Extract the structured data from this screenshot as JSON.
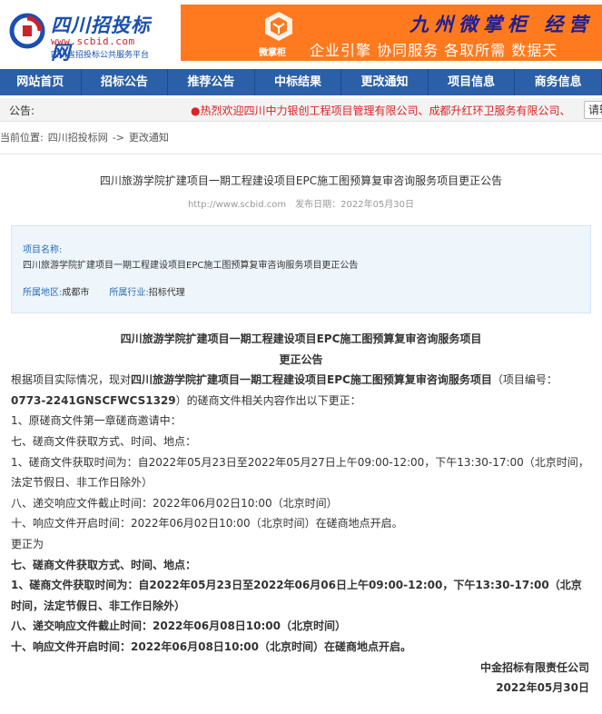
{
  "header": {
    "logo_title": "四川招投标网",
    "logo_url": "www.scbid.com",
    "logo_sub": "四川省招投标公共服务平台",
    "banner_brand": "微掌柜",
    "banner_title": "九州微掌柜 经营",
    "banner_slogan": "企业引擎 协同服务 各取所需   数据天"
  },
  "nav": {
    "items": [
      "网站首页",
      "招标公告",
      "推荐公告",
      "中标结果",
      "更改通知",
      "项目信息",
      "商务信息"
    ]
  },
  "notice": {
    "label": "公告:",
    "text": "●热烈欢迎四川中力银创工程项目管理有限公司、成都升红环卫服务有限公司、",
    "button": "请输"
  },
  "breadcrumb": {
    "prefix": "当前位置:",
    "site": "四川招投标网",
    "sep": "->",
    "current": "更改通知"
  },
  "article": {
    "title": "四川旅游学院扩建项目一期工程建设项目EPC施工图预算复审咨询服务项目更正公告",
    "url": "http://www.scbid.com",
    "date": "发布日期：2022年05月30日"
  },
  "info": {
    "project_label": "项目名称:",
    "project_name": "四川旅游学院扩建项目一期工程建设项目EPC施工图预算复审咨询服务项目更正公告",
    "region_label": "所属地区:",
    "region": "成都市",
    "industry_label": "所属行业:",
    "industry": "招标代理"
  },
  "content": {
    "heading1": "四川旅游学院扩建项目一期工程建设项目EPC施工图预算复审咨询服务项目",
    "heading2": "更正公告",
    "intro_a": "根据项目实际情况，现对",
    "intro_b": "四川旅游学院扩建项目一期工程建设项目EPC施工图预算复审咨询服务项目",
    "intro_c": "（项目编号：",
    "intro_d": "0773-2241GNSCFWCS1329",
    "intro_e": "）的磋商文件相关内容作出以下更正：",
    "line1": "1、原磋商文件第一章磋商邀请中：",
    "line2": "七、磋商文件获取方式、时间、地点：",
    "line3": "1、磋商文件获取时间为：自2022年05月23日至2022年05月27日上午09:00-12:00，下午13:30-17:00（北京时间，法定节假日、非工作日除外）",
    "line4": "八、递交响应文件截止时间：2022年06月02日10:00（北京时间）",
    "line5": "十、响应文件开启时间：2022年06月02日10:00（北京时间）在磋商地点开启。",
    "line6": "更正为",
    "line7": "七、磋商文件获取方式、时间、地点：",
    "line8": "1、磋商文件获取时间为：自2022年05月23日至2022年06月06日上午09:00-12:00，下午13:30-17:00（北京时间，法定节假日、非工作日除外）",
    "line9": "八、递交响应文件截止时间：2022年06月08日10:00（北京时间）",
    "line10": "十、响应文件开启时间：2022年06月08日10:00（北京时间）在磋商地点开启。",
    "signer": "中金招标有限责任公司",
    "sign_date": "2022年05月30日"
  },
  "colors": {
    "nav_bg": "#2b5fa8",
    "banner_bg": "#ff7a1f",
    "notice_text": "#dd2222",
    "info_bg": "#eef6fc"
  }
}
